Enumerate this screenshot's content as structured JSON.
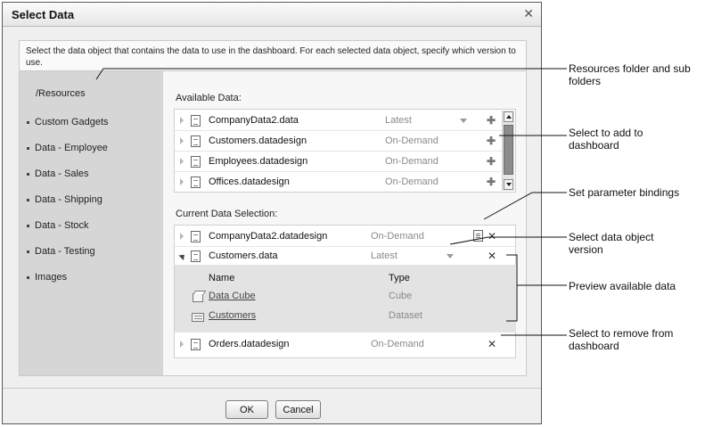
{
  "dialog": {
    "title": "Select Data",
    "close_glyph": "✕",
    "instructions": "Select the data object that contains the data to use in the dashboard. For each selected data object, specify which version to use."
  },
  "sidebar": {
    "root": "/Resources",
    "items": [
      {
        "label": "Custom Gadgets"
      },
      {
        "label": "Data - Employee"
      },
      {
        "label": "Data - Sales"
      },
      {
        "label": "Data - Shipping"
      },
      {
        "label": "Data - Stock"
      },
      {
        "label": "Data - Testing"
      },
      {
        "label": "Images"
      }
    ]
  },
  "available": {
    "label": "Available Data:",
    "rows": [
      {
        "name": "CompanyData2.data",
        "version": "Latest"
      },
      {
        "name": "Customers.datadesign",
        "version": "On-Demand"
      },
      {
        "name": "Employees.datadesign",
        "version": "On-Demand"
      },
      {
        "name": "Offices.datadesign",
        "version": "On-Demand"
      }
    ]
  },
  "current": {
    "label": "Current Data Selection:",
    "rows": [
      {
        "name": "CompanyData2.datadesign",
        "version": "On-Demand"
      },
      {
        "name": "Customers.data",
        "version": "Latest"
      },
      {
        "name": "Orders.datadesign",
        "version": "On-Demand"
      }
    ],
    "preview": {
      "col_name": "Name",
      "col_type": "Type",
      "items": [
        {
          "name": "Data Cube",
          "type": "Cube",
          "icon": "cube-icon"
        },
        {
          "name": "Customers",
          "type": "Dataset",
          "icon": "dataset-icon"
        }
      ]
    }
  },
  "buttons": {
    "ok": "OK",
    "cancel": "Cancel"
  },
  "callouts": {
    "resources": "Resources folder and sub folders",
    "add": "Select to add to dashboard",
    "params": "Set parameter bindings",
    "version": "Select data object version",
    "preview": "Preview available data",
    "remove": "Select to remove from dashboard"
  }
}
